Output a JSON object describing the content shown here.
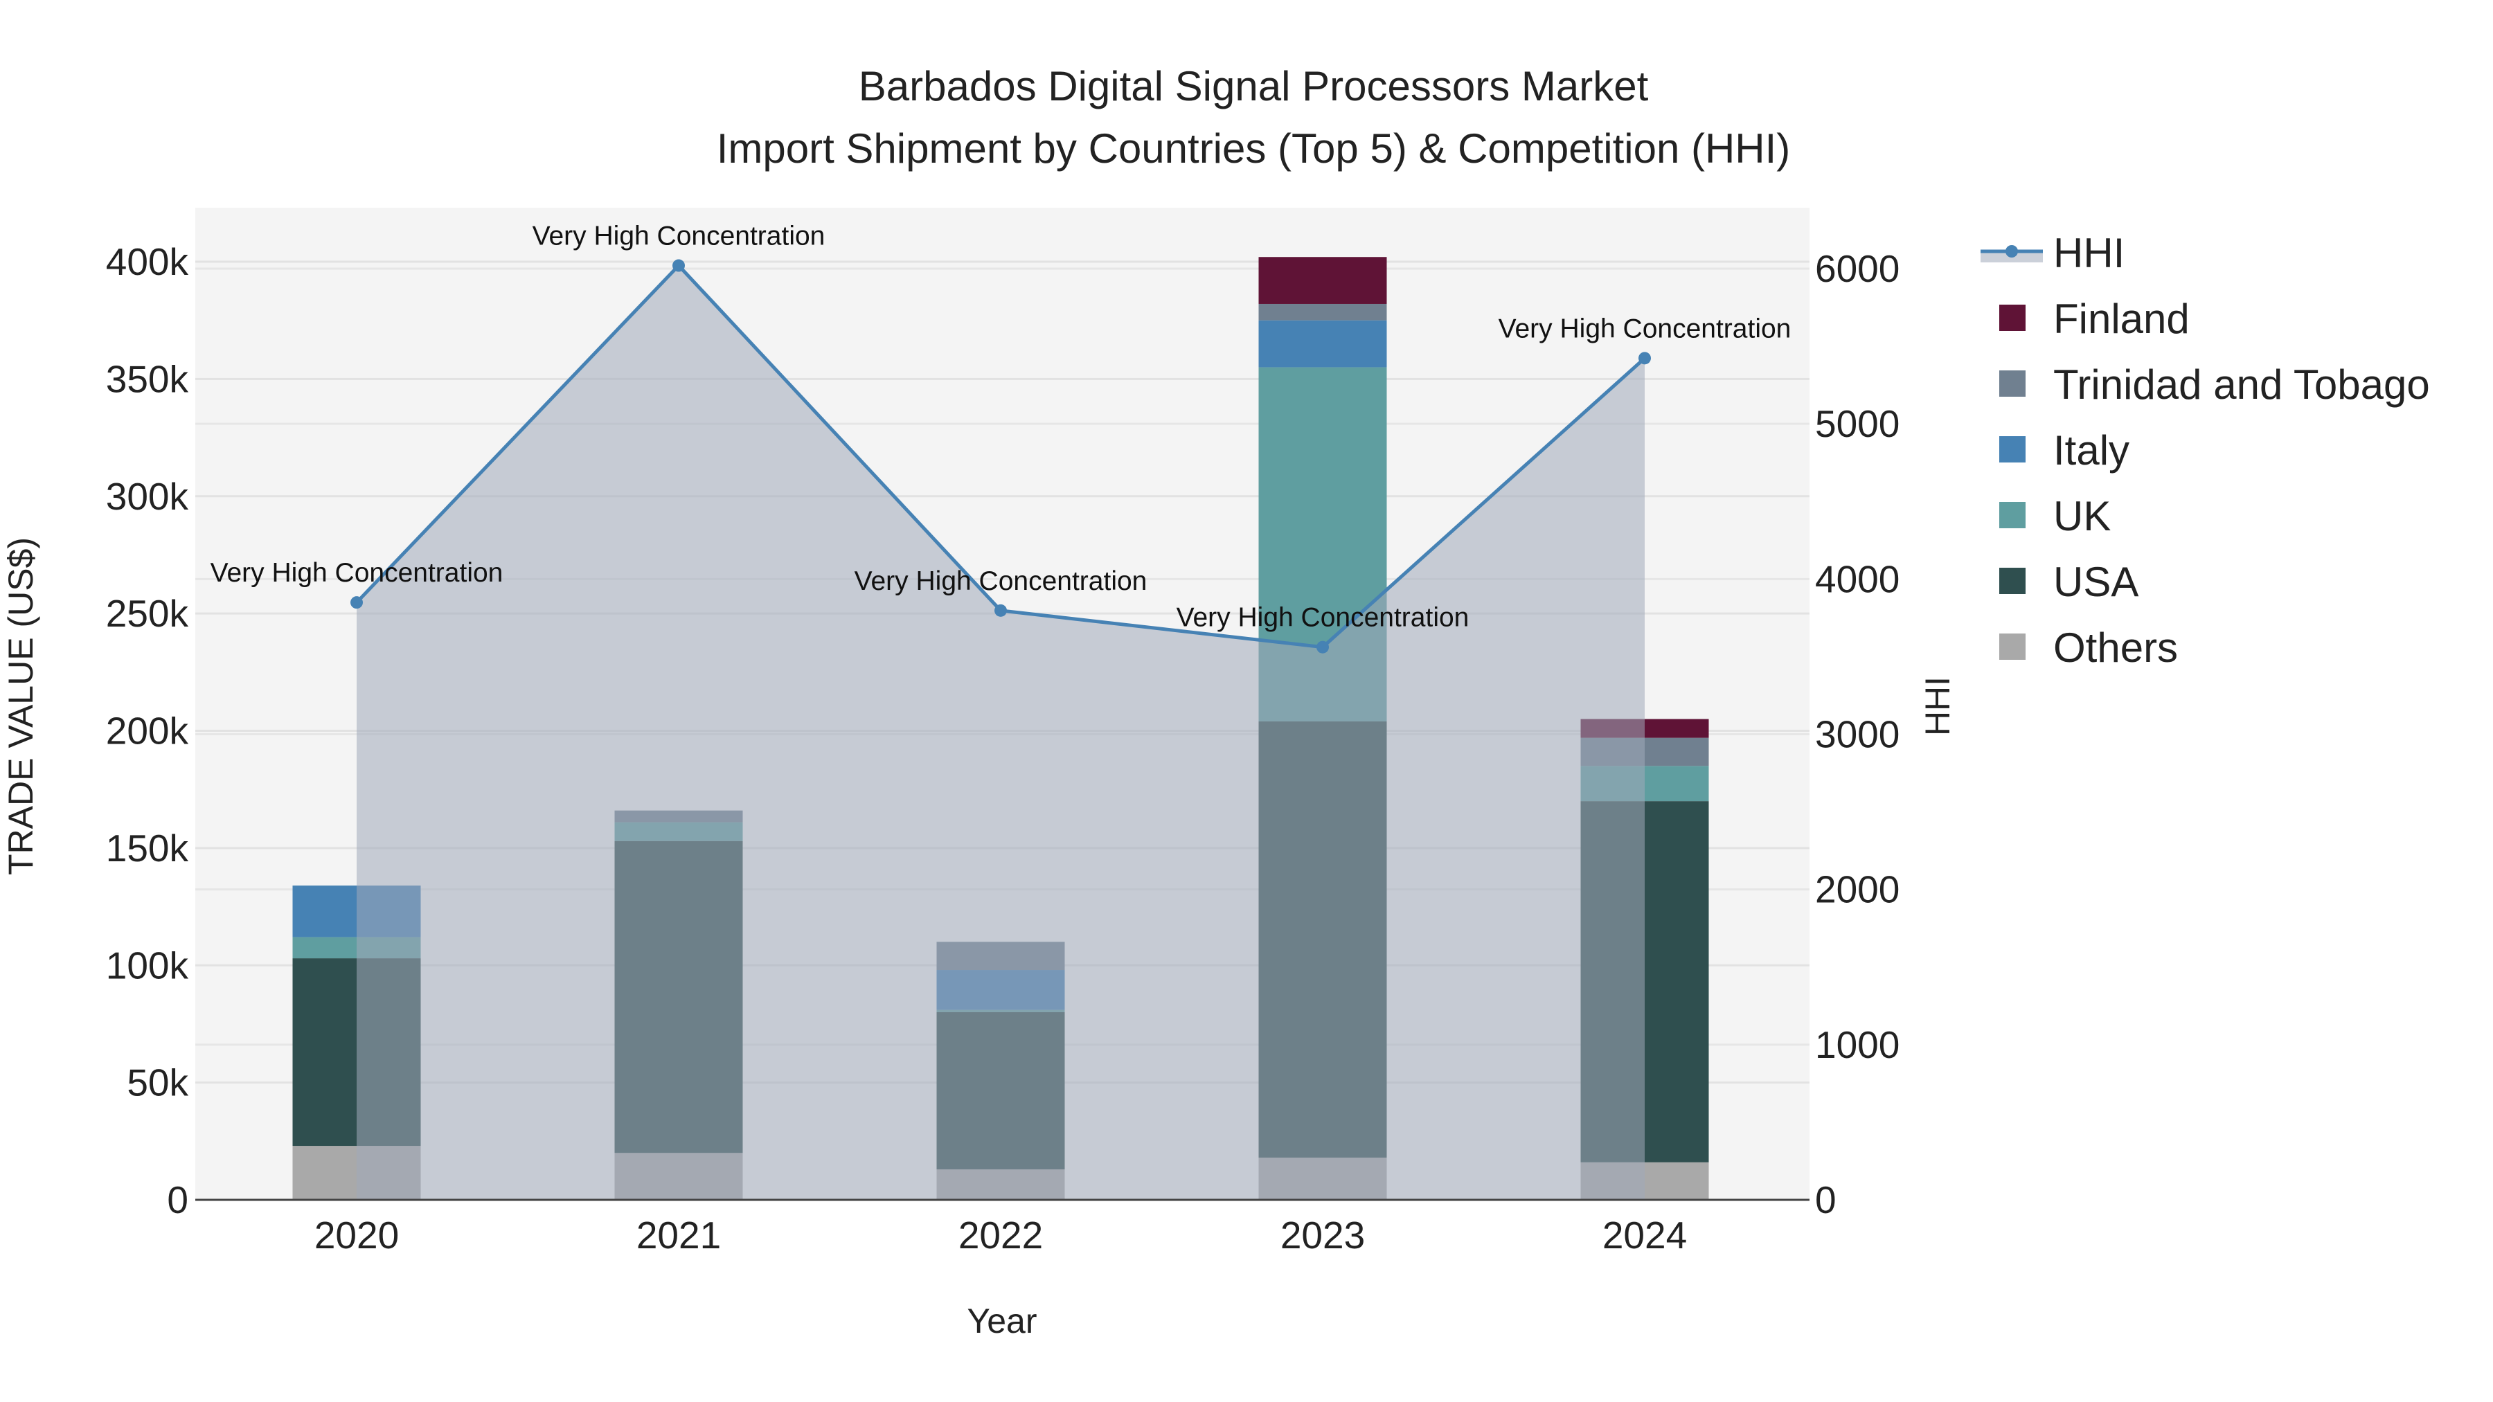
{
  "chart_data": {
    "type": "bar",
    "title": "Barbados Digital Signal Processors Market",
    "subtitle": "Import Shipment by Countries (Top 5) & Competition (HHI)",
    "xlabel": "Year",
    "ylabel": "TRADE VALUE (US$)",
    "y2label": "HHI",
    "categories": [
      "2020",
      "2021",
      "2022",
      "2023",
      "2024"
    ],
    "ylim": [
      0,
      420000
    ],
    "y2lim": [
      0,
      6300
    ],
    "yticks": [
      0,
      50000,
      100000,
      150000,
      200000,
      250000,
      300000,
      350000,
      400000
    ],
    "ytick_labels": [
      "0",
      "50k",
      "100k",
      "150k",
      "200k",
      "250k",
      "300k",
      "350k",
      "400k"
    ],
    "y2ticks": [
      0,
      1000,
      2000,
      3000,
      4000,
      5000,
      6000
    ],
    "y2tick_labels": [
      "0",
      "1000",
      "2000",
      "3000",
      "4000",
      "5000",
      "6000"
    ],
    "stacked": true,
    "series": [
      {
        "name": "Others",
        "color": "#a9a9a9",
        "values": [
          23000,
          20000,
          13000,
          18000,
          16000
        ]
      },
      {
        "name": "USA",
        "color": "#2f4f4f",
        "values": [
          80000,
          133000,
          67000,
          186000,
          154000
        ]
      },
      {
        "name": "UK",
        "color": "#5f9ea0",
        "values": [
          9000,
          8000,
          1000,
          151000,
          15000
        ]
      },
      {
        "name": "Italy",
        "color": "#4682b4",
        "values": [
          22000,
          0,
          17000,
          20000,
          0
        ]
      },
      {
        "name": "Trinidad and Tobago",
        "color": "#708090",
        "values": [
          0,
          5000,
          12000,
          7000,
          12000
        ]
      },
      {
        "name": "Finland",
        "color": "#5f1336",
        "values": [
          0,
          0,
          0,
          20000,
          8000
        ]
      }
    ],
    "hhi": {
      "name": "HHI",
      "color": "#4682b4",
      "values": [
        3849,
        6020,
        3797,
        3561,
        5423
      ],
      "annotations": [
        "Very High Concentration",
        "Very High Concentration",
        "Very High Concentration",
        "Very High Concentration",
        "Very High Concentration"
      ]
    },
    "legend": [
      "HHI",
      "Finland",
      "Trinidad and Tobago",
      "Italy",
      "UK",
      "USA",
      "Others"
    ],
    "legend_placement": "right",
    "grid": true
  }
}
